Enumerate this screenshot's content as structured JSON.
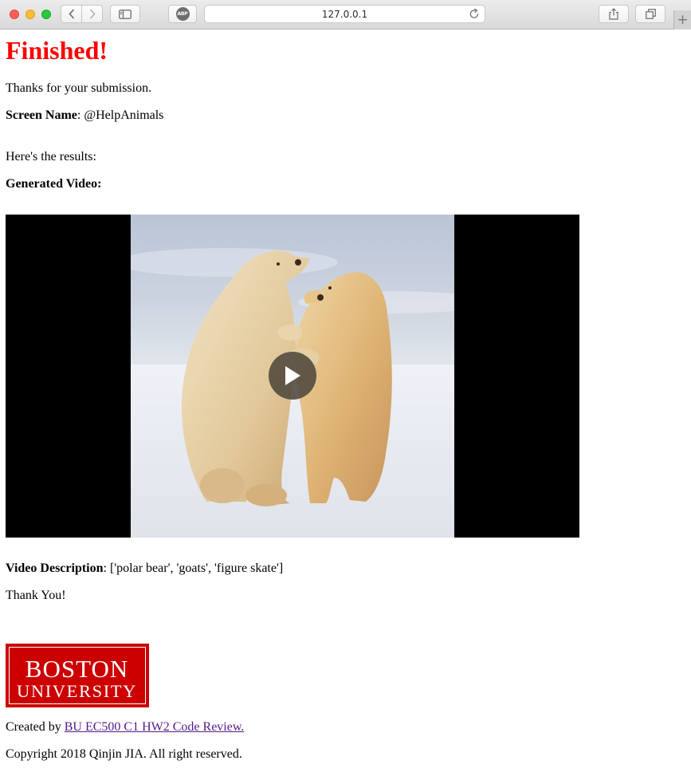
{
  "browser": {
    "url": "127.0.0.1",
    "abp_label": "ABP",
    "new_tab_label": "+"
  },
  "page": {
    "heading": "Finished!",
    "thanks": "Thanks for your submission.",
    "screen_name_label": "Screen Name",
    "screen_name_value": ": @HelpAnimals",
    "results_intro": "Here's the results:",
    "generated_video_label": "Generated Video:",
    "video_description_label": "Video Description",
    "video_description_value": ": ['polar bear', 'goats', 'figure skate']",
    "thank_you": "Thank You!",
    "logo": {
      "line1": "BOSTON",
      "line2": "UNIVERSITY"
    },
    "created_by_prefix": "Created by ",
    "created_by_link": "BU EC500 C1 HW2 Code Review.",
    "copyright": "Copyright 2018 Qinjin JIA. All right reserved."
  },
  "colors": {
    "heading": "#ff0000",
    "bu_red": "#cc0000",
    "link": "#551a8b"
  },
  "icons": [
    "back-icon",
    "forward-icon",
    "sidebar-icon",
    "reload-icon",
    "share-icon",
    "tabs-icon",
    "play-icon"
  ]
}
